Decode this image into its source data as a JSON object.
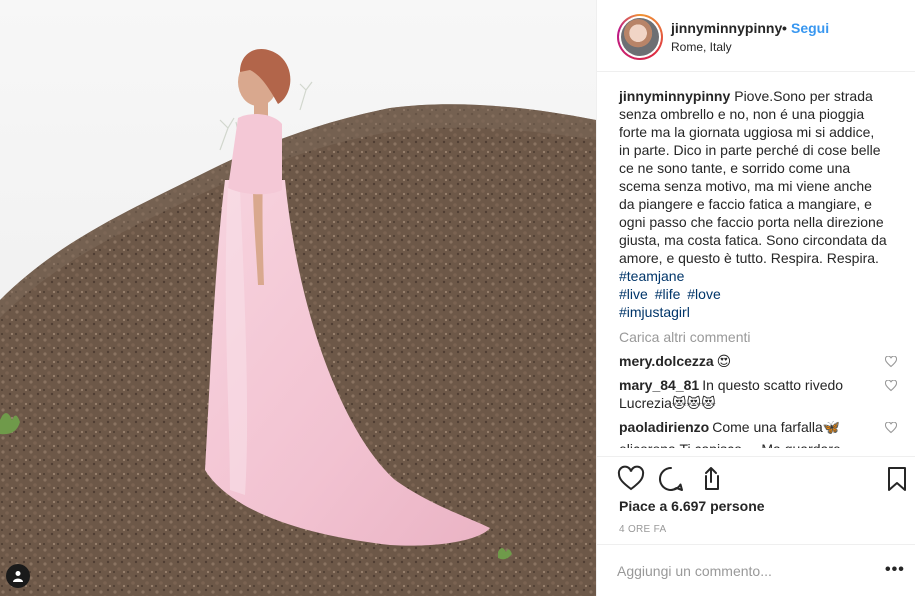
{
  "post": {
    "username": "jinnyminnypinny",
    "separator": "•",
    "follow_label": "Segui",
    "location": "Rome, Italy",
    "caption": "Piove.Sono per strada senza ombrello e no, non é una pioggia forte ma la giornata uggiosa mi si addice, in parte. Dico in parte perché di cose belle ce ne sono tante, e sorrido come una scema senza motivo, ma mi viene anche da piangere e faccio fatica a mangiare, e ogni passo che faccio porta nella direzione giusta, ma costa fatica. Sono circondata da amore, e questo è tutto. Respira. Respira.",
    "hashtags": [
      [
        "#teamjane"
      ],
      [
        "#live",
        "#life",
        "#love"
      ],
      [
        "#imjustagirl"
      ]
    ],
    "load_more": "Carica altri commenti",
    "comments": [
      {
        "user": "mery.dolcezza",
        "text": "😍"
      },
      {
        "user": "mary_84_81",
        "text": "In questo scatto rivedo Lucrezia😻😻😻"
      },
      {
        "user": "paoladirienzo",
        "text": "Come una farfalla🦋"
      }
    ],
    "partial_comment": "elicorona Ti capisco ... Ma guardare",
    "likes": "Piace a 6.697 persone",
    "time": "4 ORE FA",
    "add_comment_placeholder": "Aggiungi un commento...",
    "more_options": "•••"
  },
  "icons": [
    "tag-person-icon",
    "heart-icon",
    "comment-icon",
    "share-icon",
    "bookmark-icon",
    "heart-small-icon"
  ],
  "colors": {
    "link": "#3897f0",
    "hashtag": "#003569",
    "muted": "#999999",
    "text": "#262626"
  }
}
